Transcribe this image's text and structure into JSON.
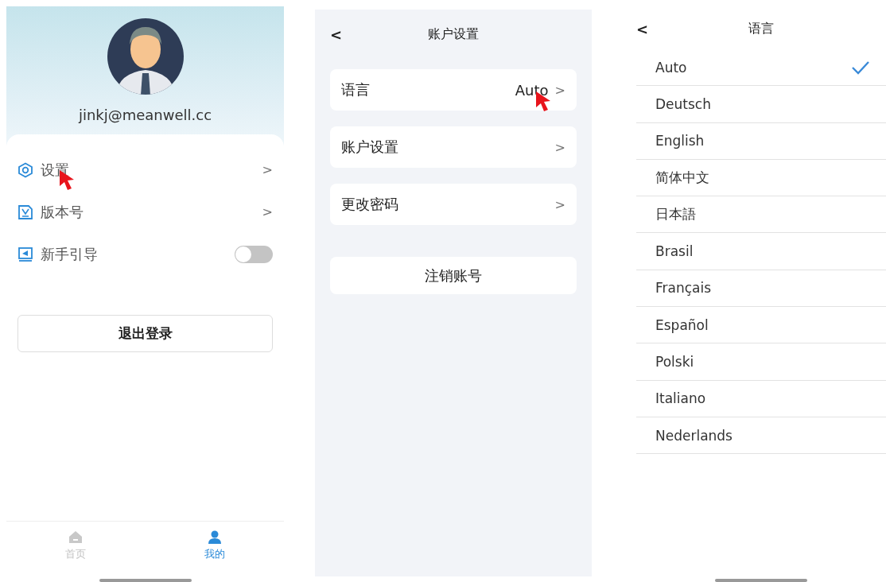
{
  "profile_screen": {
    "email": "jinkj@meanwell.cc",
    "menu": [
      {
        "kind": "link",
        "label": "设置",
        "chevron": ">",
        "cursor": true
      },
      {
        "kind": "link",
        "label": "版本号",
        "chevron": ">",
        "cursor": false
      },
      {
        "kind": "toggle",
        "label": "新手引导",
        "on": false,
        "cursor": false
      }
    ],
    "logout_button": "退出登录",
    "tabs": [
      {
        "label": "首页",
        "selected": false
      },
      {
        "label": "我的",
        "selected": true
      }
    ]
  },
  "account_screen": {
    "back": "<",
    "title": "账户设置",
    "rows": [
      {
        "label": "语言",
        "value": "Auto",
        "chevron": ">",
        "cursor": true
      },
      {
        "label": "账户设置",
        "chevron": ">",
        "cursor": false
      },
      {
        "label": "更改密码",
        "chevron": ">",
        "cursor": false
      }
    ],
    "delete_button": "注销账号"
  },
  "language_screen": {
    "back": "<",
    "title": "语言",
    "options": [
      {
        "label": "Auto",
        "selected": true
      },
      {
        "label": "Deutsch",
        "selected": false
      },
      {
        "label": "English",
        "selected": false
      },
      {
        "label": "简体中文",
        "selected": false
      },
      {
        "label": "日本語",
        "selected": false
      },
      {
        "label": "Brasil",
        "selected": false
      },
      {
        "label": "Français",
        "selected": false
      },
      {
        "label": "Español",
        "selected": false
      },
      {
        "label": "Polski",
        "selected": false
      },
      {
        "label": "Italiano",
        "selected": false
      },
      {
        "label": "Nederlands",
        "selected": false
      }
    ]
  }
}
